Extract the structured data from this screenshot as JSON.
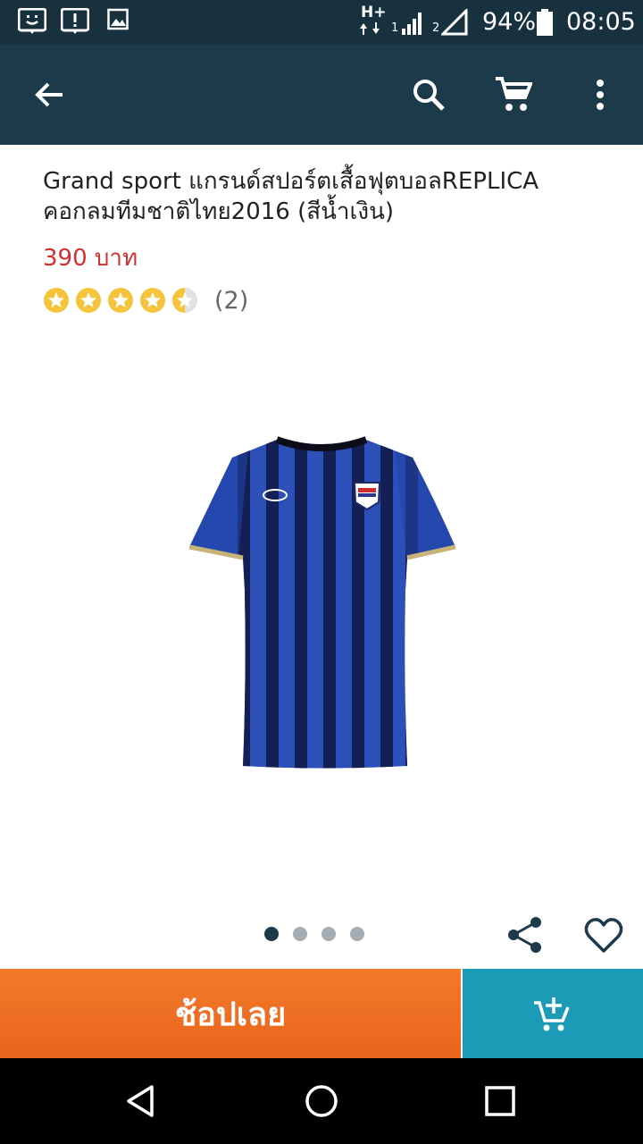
{
  "status_bar": {
    "network_type": "H+",
    "sim1": "1",
    "sim2": "2",
    "battery": "94%",
    "time": "08:05"
  },
  "app_bar": {
    "icons": [
      "back-arrow-icon",
      "search-icon",
      "cart-icon",
      "more-vert-icon"
    ]
  },
  "product": {
    "title": "Grand sport แกรนด์สปอร์ตเสื้อฟุตบอลREPLICA คอกลมทีมชาติไทย2016 (สีน้ำเงิน)",
    "price": "390 บาท",
    "rating": 4.5,
    "rating_count": "(2)",
    "image_count": 4,
    "active_image": 1
  },
  "actions": {
    "buy_now_label": "ช้อปเลย",
    "add_to_cart_icon": "add-to-cart-icon",
    "share_icon": "share-icon",
    "favorite_icon": "heart-icon"
  },
  "colors": {
    "status_bar": "#17313f",
    "app_bar": "#1d3a4a",
    "price": "#d32f2f",
    "star": "#f5c43a",
    "buy_button": "#f07020",
    "cart_button": "#1b9bb5"
  }
}
